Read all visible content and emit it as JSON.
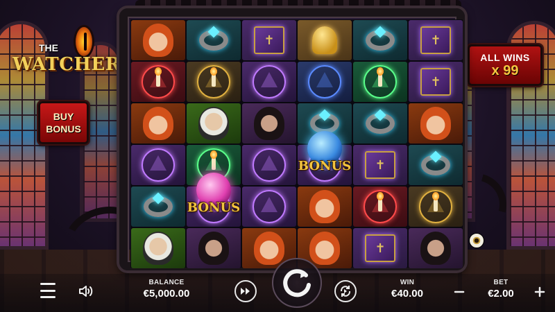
{
  "game": {
    "logo_the": "THE",
    "logo_watcher": "WATCHER",
    "buy_bonus": {
      "line1": "BUY",
      "line2": "BONUS"
    },
    "all_wins": {
      "label": "ALL WINS",
      "multiplier": "x 99"
    }
  },
  "reels": {
    "rows": [
      [
        "witch",
        "ring",
        "book",
        "bell",
        "ring",
        "book"
      ],
      [
        "candle-red",
        "candle-gold",
        "sym-purple",
        "sym-blue",
        "sym-green",
        "book"
      ],
      [
        "witch",
        "priest",
        "man",
        "ring",
        "ring",
        "witch"
      ],
      [
        "sym-purple",
        "sym-green",
        "sym-purple",
        "bonus",
        "book",
        "ring"
      ],
      [
        "ring",
        "bonus",
        "sym-purple",
        "witch",
        "candle-red",
        "candle-gold"
      ],
      [
        "priest",
        "man",
        "witch",
        "witch",
        "book",
        "man"
      ]
    ],
    "bonus_label": "BONUS"
  },
  "controls": {
    "balance_label": "BALANCE",
    "balance_value": "€5,000.00",
    "win_label": "WIN",
    "win_value": "€40.00",
    "bet_label": "BET",
    "bet_value": "€2.00",
    "icons": [
      "menu-icon",
      "sound-icon",
      "turbo-icon",
      "spin-icon",
      "autoplay-icon",
      "minus-icon",
      "plus-icon"
    ]
  },
  "colors": {
    "accent_gold": "#f2c440",
    "panel_red": "#b01212",
    "bonus_blue": "#3a8ae0",
    "bonus_pink": "#e040b0"
  }
}
